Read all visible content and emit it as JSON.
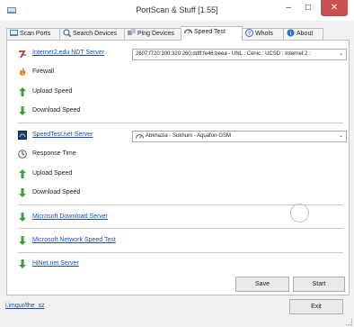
{
  "window": {
    "title": "PortScan & Stuff [1.55]"
  },
  "tabs": [
    {
      "label": "Scan Ports",
      "icon": "scan-ports-icon"
    },
    {
      "label": "Search Devices",
      "icon": "search-devices-icon"
    },
    {
      "label": "Ping Devices",
      "icon": "ping-devices-icon"
    },
    {
      "label": "Speed Test",
      "icon": "speed-test-icon",
      "active": true
    },
    {
      "label": "WhoIs",
      "icon": "whois-icon"
    },
    {
      "label": "About",
      "icon": "about-icon"
    }
  ],
  "ndt": {
    "link": "Internet2.edu NDT Server",
    "server": "2607:f720:300:320:260:ddff:fe46:beea - UNL : Cenic : UCSD : Internet 2 :",
    "firewall": "Firewall",
    "upload": "Upload Speed",
    "download": "Download Speed"
  },
  "speedtest": {
    "link": "SpeedTest.net Server",
    "server": "Abkhazia - Sukhum - Aquafon-GSM",
    "response": "Response Time",
    "upload": "Upload Speed",
    "download": "Download Speed"
  },
  "links": {
    "microsoft_download": "Microsoft Download Server",
    "microsoft_network": "Microsoft Network Speed Test",
    "hinet": "HiNet.net Server"
  },
  "buttons": {
    "save": "Save",
    "start": "Start",
    "exit": "Exit"
  },
  "footer": {
    "link": "i.imgur/the_sz"
  },
  "colors": {
    "link": "#1a4fb0",
    "close": "#c75050",
    "arrow_green": "#3aa13a",
    "arrow_down_green": "#3f9a3a"
  }
}
